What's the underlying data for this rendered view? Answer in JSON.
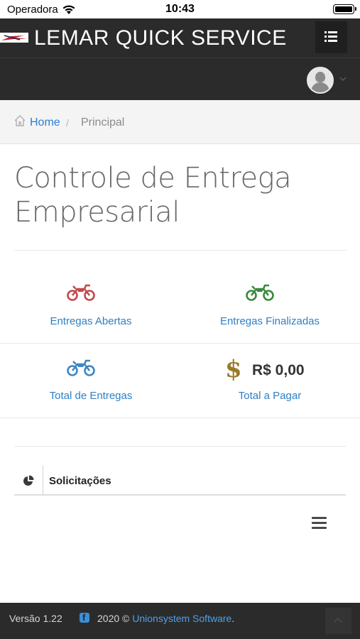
{
  "status_bar": {
    "carrier": "Operadora",
    "time": "10:43"
  },
  "header": {
    "brand": "LEMAR QUICK SERVICE",
    "menu_icon": "list-icon",
    "avatar_icon": "user-avatar"
  },
  "breadcrumb": {
    "home": "Home",
    "separator": "/",
    "current": "Principal"
  },
  "page": {
    "title": "Controle de Entrega Empresarial"
  },
  "stats": {
    "open": {
      "label": "Entregas Abertas",
      "icon": "motorcycle-icon",
      "color": "#c24a4a"
    },
    "finished": {
      "label": "Entregas Finalizadas",
      "icon": "motorcycle-icon",
      "color": "#3a8a3a"
    },
    "total": {
      "label": "Total de Entregas",
      "icon": "motorcycle-icon",
      "color": "#3f86c4"
    },
    "to_pay": {
      "label": "Total a Pagar",
      "value": "R$ 0,00",
      "icon": "dollar-icon",
      "symbol": "$",
      "color": "#9a7a2a"
    }
  },
  "panel": {
    "title": "Solicitações",
    "icon": "pie-chart-icon"
  },
  "footer": {
    "version": "Versão 1.22",
    "copyright": "2020 ©",
    "company": "Unionsystem Software",
    "period": "."
  }
}
